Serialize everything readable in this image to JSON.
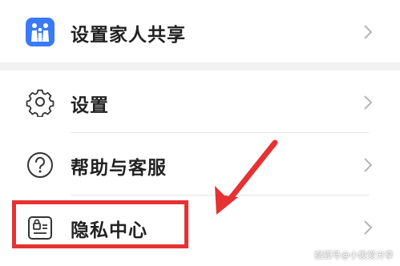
{
  "menu": {
    "items": [
      {
        "label": "设置家人共享",
        "icon": "family-sharing-icon"
      },
      {
        "label": "设置",
        "icon": "gear-icon"
      },
      {
        "label": "帮助与客服",
        "icon": "help-icon"
      },
      {
        "label": "隐私中心",
        "icon": "privacy-id-icon"
      }
    ]
  },
  "annotation": {
    "highlight_color": "#e53232",
    "arrow_color": "#e53232",
    "highlighted_item": "隐私中心"
  },
  "watermark": "搜狐号@小俊爱分享",
  "colors": {
    "background": "#f1f1f1",
    "card": "#ffffff",
    "family_icon_bg": "#3a7bf5"
  }
}
